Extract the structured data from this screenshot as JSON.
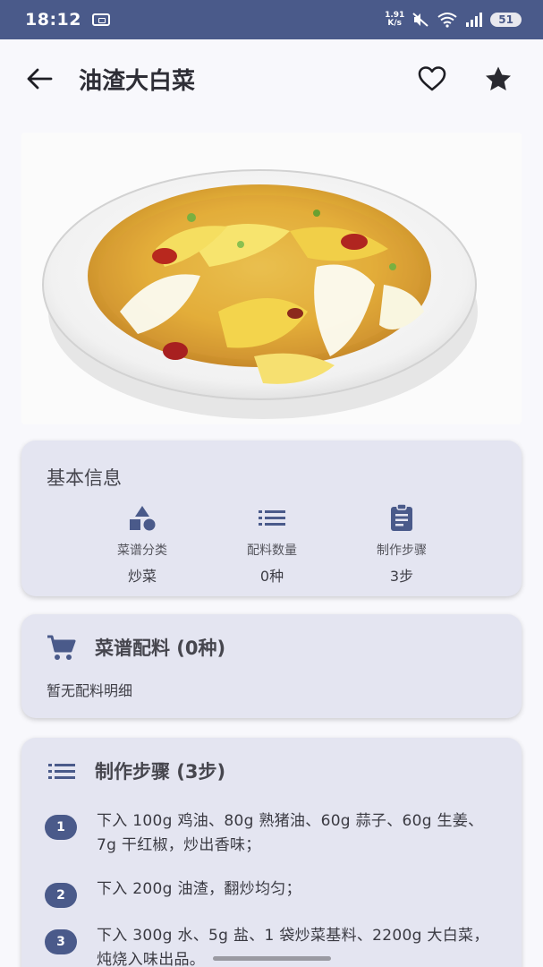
{
  "status_bar": {
    "time": "18:12",
    "speed_top": "1.91",
    "speed_bottom": "K/s",
    "battery": "51"
  },
  "app_bar": {
    "title": "油渣大白菜",
    "back_icon": "arrow-left-icon",
    "favorite_icon": "heart-outline-icon",
    "star_icon": "star-icon"
  },
  "colors": {
    "primary": "#4a5a8a",
    "card_bg": "#e4e5f1",
    "page_bg": "#f8f8fc"
  },
  "basic_info": {
    "title": "基本信息",
    "items": [
      {
        "icon": "category-icon",
        "label": "菜谱分类",
        "value": "炒菜"
      },
      {
        "icon": "list-icon",
        "label": "配料数量",
        "value": "0种"
      },
      {
        "icon": "clipboard-icon",
        "label": "制作步骤",
        "value": "3步"
      }
    ]
  },
  "ingredients": {
    "icon": "shopping-cart-icon",
    "title": "菜谱配料 (0种)",
    "empty_text": "暂无配料明细"
  },
  "steps": {
    "icon": "list-icon",
    "title": "制作步骤 (3步)",
    "items": [
      {
        "num": "1",
        "text": "下入 100g 鸡油、80g 熟猪油、60g 蒜子、60g 生姜、7g 干红椒，炒出香味；"
      },
      {
        "num": "2",
        "text": "下入 200g 油渣，翻炒均匀；"
      },
      {
        "num": "3",
        "text": "下入 300g 水、5g 盐、1 袋炒菜基料、2200g 大白菜，炖烧入味出品。"
      }
    ]
  }
}
